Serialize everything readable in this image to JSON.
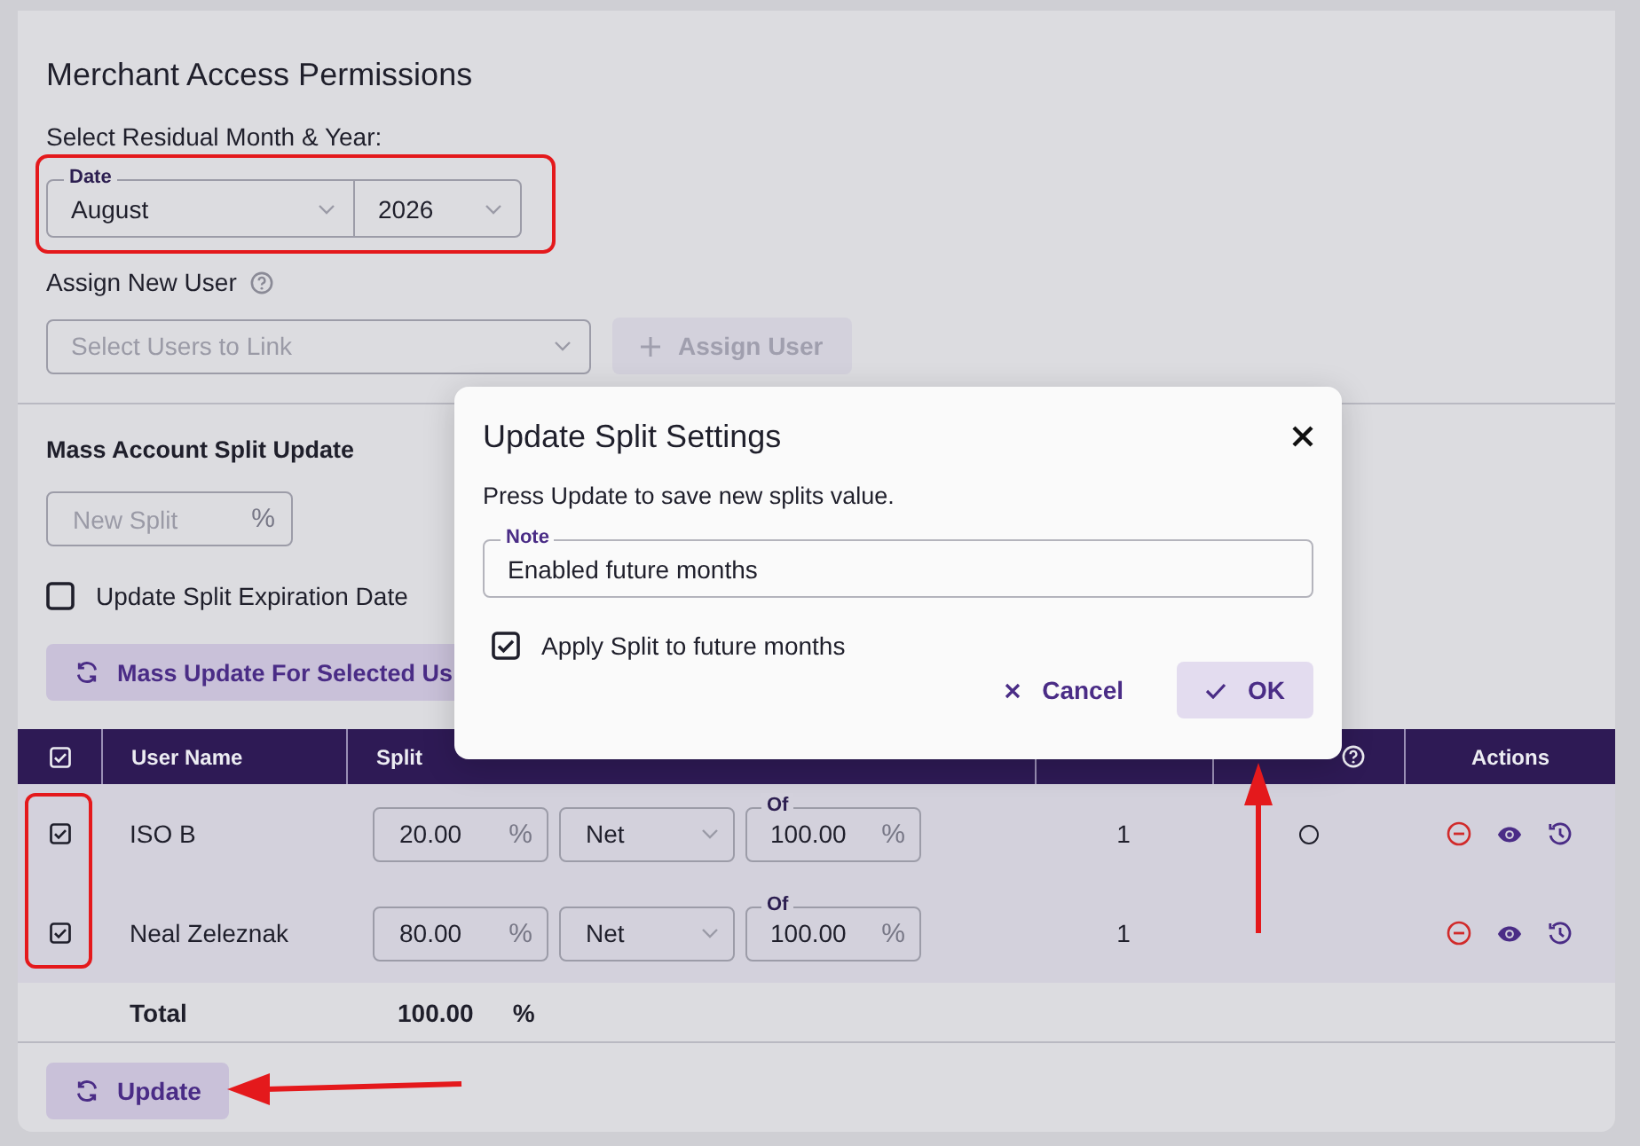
{
  "page": {
    "title": "Merchant Access Permissions",
    "date_prompt": "Select Residual Month & Year:",
    "date": {
      "label": "Date",
      "month": "August",
      "year": "2026"
    },
    "assign": {
      "label": "Assign New User",
      "placeholder": "Select Users to Link",
      "button": "Assign User",
      "disabled": true
    }
  },
  "mass_update": {
    "title": "Mass Account Split Update",
    "placeholder": "New Split",
    "unit": "%",
    "expiration": {
      "label": "Update Split Expiration Date",
      "checked": false
    },
    "button": "Mass Update For Selected Us"
  },
  "table": {
    "header_checked": true,
    "columns": [
      {
        "kind": "text",
        "label": "User Name"
      },
      {
        "kind": "text",
        "label": "Split"
      },
      {
        "kind": "covered"
      },
      {
        "kind": "help"
      },
      {
        "kind": "text",
        "label": "Actions"
      }
    ],
    "rows": [
      {
        "checked": true,
        "name": "ISO B",
        "split": "20.00",
        "unit": "%",
        "basis": "Net",
        "of_label": "Of",
        "of": "100.00",
        "of_unit": "%",
        "pay_level": "1",
        "primary": {
          "kind": "radio",
          "selected": false
        },
        "actions": [
          {
            "kind": "remove"
          },
          {
            "kind": "view"
          },
          {
            "kind": "history"
          }
        ]
      },
      {
        "checked": true,
        "name": "Neal Zeleznak",
        "split": "80.00",
        "unit": "%",
        "basis": "Net",
        "of_label": "Of",
        "of": "100.00",
        "of_unit": "%",
        "pay_level": "1",
        "actions": [
          {
            "kind": "remove"
          },
          {
            "kind": "view"
          },
          {
            "kind": "history"
          }
        ]
      }
    ],
    "total": {
      "label": "Total",
      "value": "100.00",
      "unit": "%"
    }
  },
  "update_button": "Update",
  "dialog": {
    "title": "Update Split Settings",
    "message": "Press Update to save new splits value.",
    "note": {
      "label": "Note",
      "value": "Enabled future months"
    },
    "apply_future": {
      "label": "Apply Split to future months",
      "checked": true
    },
    "buttons": [
      {
        "kind": "cancel",
        "label": "Cancel"
      },
      {
        "kind": "ok",
        "label": "OK"
      }
    ]
  }
}
